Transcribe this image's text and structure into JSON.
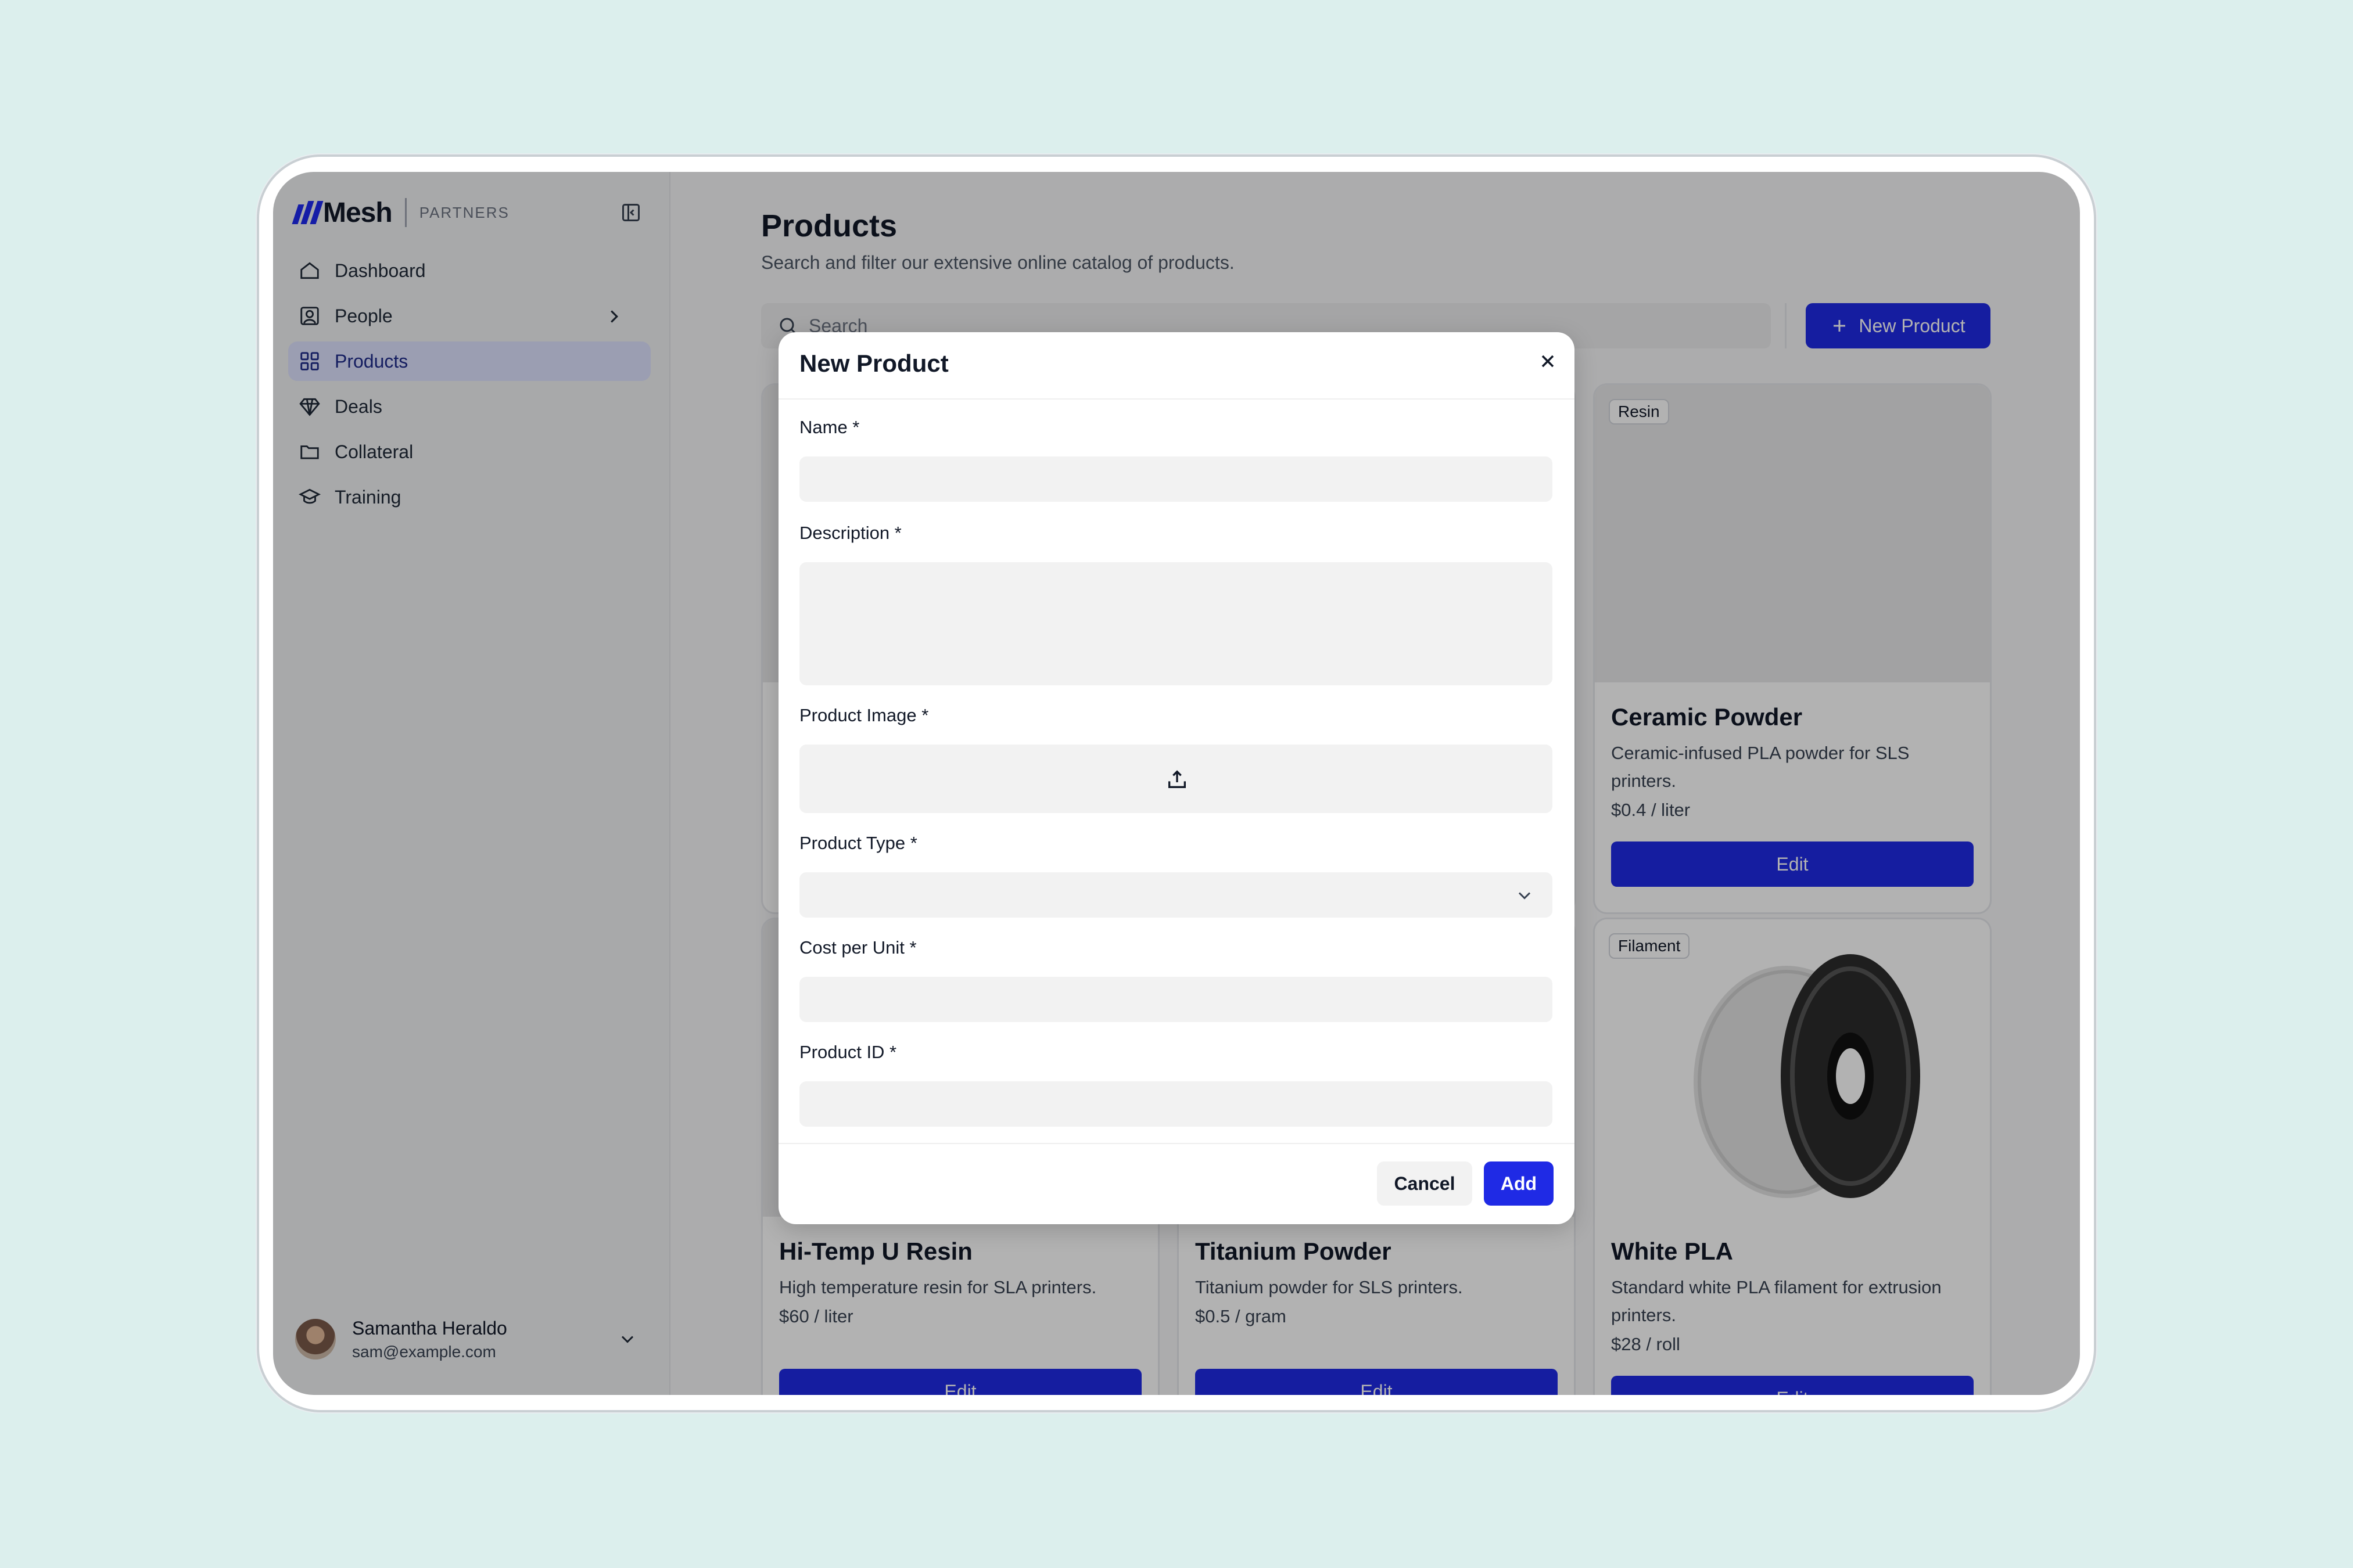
{
  "brand": {
    "name": "Mesh",
    "subtitle": "PARTNERS"
  },
  "sidebar": {
    "items": [
      {
        "label": "Dashboard",
        "icon": "home-icon"
      },
      {
        "label": "People",
        "icon": "user-square-icon"
      },
      {
        "label": "Products",
        "icon": "grid-icon",
        "active": true
      },
      {
        "label": "Deals",
        "icon": "diamond-icon"
      },
      {
        "label": "Collateral",
        "icon": "folder-icon"
      },
      {
        "label": "Training",
        "icon": "graduation-cap-icon"
      }
    ]
  },
  "user": {
    "name": "Samantha Heraldo",
    "email": "sam@example.com"
  },
  "page": {
    "title": "Products",
    "subtitle": "Search and filter our extensive online catalog of products.",
    "search_placeholder": "Search",
    "new_button": "New Product"
  },
  "products": [
    {
      "badge": "Resin",
      "title": "Ceramic Powder",
      "desc": "Ceramic-infused PLA powder for SLS printers.",
      "price": "$0.4 / liter",
      "button": "Edit"
    },
    {
      "title": "Hi-Temp U Resin",
      "desc": "High temperature resin for SLA printers.",
      "price": "$60 / liter",
      "button": "Edit"
    },
    {
      "title": "Titanium Powder",
      "desc": "Titanium powder for SLS printers.",
      "price": "$0.5 / gram",
      "button": "Edit"
    },
    {
      "badge": "Filament",
      "title": "White PLA",
      "desc": "Standard white PLA filament for extrusion printers.",
      "price": "$28 / roll",
      "button": "Edit"
    }
  ],
  "modal": {
    "title": "New Product",
    "fields": {
      "name": "Name *",
      "description": "Description *",
      "image": "Product Image *",
      "type": "Product Type *",
      "cost": "Cost per Unit *",
      "id": "Product ID *"
    },
    "cancel": "Cancel",
    "add": "Add"
  },
  "colors": {
    "accent": "#1f2ae5",
    "background": "#dcefed"
  }
}
